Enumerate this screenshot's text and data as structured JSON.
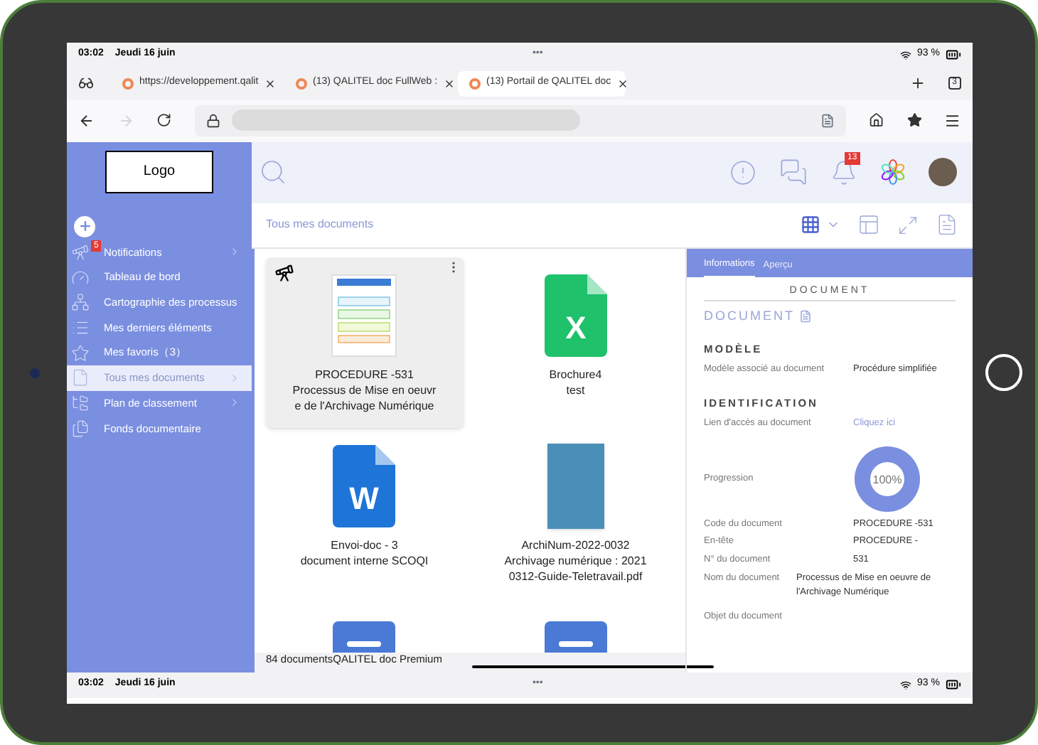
{
  "status_bar": {
    "time": "03:02",
    "date": "Jeudi 16 juin",
    "dots": "•••",
    "battery": "93 %"
  },
  "browser": {
    "tabs": [
      {
        "title": "https://developpement.qalit",
        "selected": false
      },
      {
        "title": "(13) QALITEL doc FullWeb :",
        "selected": false
      },
      {
        "title": "(13) Portail de QALITEL doc",
        "selected": true
      }
    ],
    "tab_count": "3"
  },
  "sidebar": {
    "logo": "Logo",
    "items": [
      {
        "label": "Notifications",
        "badge": "5",
        "chevron": true,
        "selected": false
      },
      {
        "label": "Tableau de bord",
        "chevron": false,
        "selected": false
      },
      {
        "label": "Cartographie des processus",
        "chevron": false,
        "selected": false
      },
      {
        "label": "Mes derniers éléments",
        "chevron": false,
        "selected": false
      },
      {
        "label": "Mes favoris（3）",
        "chevron": false,
        "selected": false
      },
      {
        "label": "Tous mes documents",
        "chevron": true,
        "selected": true
      },
      {
        "label": "Plan de classement",
        "chevron": true,
        "selected": false
      },
      {
        "label": "Fonds documentaire",
        "chevron": false,
        "selected": false
      }
    ]
  },
  "header": {
    "notification_count": "13"
  },
  "breadcrumb": "Tous mes documents",
  "files": [
    {
      "kind": "procedure",
      "lines": [
        "PROCEDURE -531",
        "Processus de Mise en oeuvr",
        "e de l'Archivage Numérique"
      ],
      "selected": true
    },
    {
      "kind": "excel",
      "icon_letter": "X",
      "lines": [
        "Brochure4",
        "test"
      ],
      "selected": false
    },
    {
      "kind": "word",
      "icon_letter": "W",
      "lines": [
        "Envoi-doc - 3",
        "document interne SCOQI"
      ],
      "selected": false
    },
    {
      "kind": "cover",
      "lines": [
        "ArchiNum-2022-0032",
        "Archivage numérique : 2021",
        "0312-Guide-Teletravail.pdf"
      ],
      "selected": false
    },
    {
      "kind": "doc",
      "selected": false
    },
    {
      "kind": "doc",
      "selected": false
    }
  ],
  "footer": "84 documentsQALITEL doc Premium",
  "panel": {
    "tabs": [
      {
        "label": "Informations",
        "selected": true
      },
      {
        "label": "Aperçu",
        "selected": false
      }
    ],
    "section_title": "DOCUMENT",
    "doc_label": "DOCUMENT",
    "groups": [
      {
        "title": "MODÈLE",
        "rows": [
          {
            "kind": "text",
            "label": "Modèle associé au document",
            "value": "Procédure simplifiée"
          }
        ]
      },
      {
        "title": "IDENTIFICATION",
        "rows": [
          {
            "kind": "link",
            "label": "Lien d'accès au document",
            "value": "Cliquez ici"
          },
          {
            "kind": "progress",
            "label": "Progression",
            "value": "100%",
            "level": 1
          },
          {
            "kind": "text",
            "label": "Code du document",
            "value": "PROCEDURE -531"
          },
          {
            "kind": "text",
            "label": "En-tête",
            "value": "PROCEDURE -"
          },
          {
            "kind": "text",
            "label": "N° du document",
            "value": "531"
          },
          {
            "kind": "wide",
            "label": "Nom du document",
            "value": "Processus de Mise en oeuvre de l'Archivage Numérique"
          },
          {
            "kind": "text",
            "label": "Objet du document"
          }
        ]
      }
    ]
  },
  "bottom_status": {
    "time": "03:02",
    "date": "Jeudi 16 juin",
    "dots": "•••",
    "battery": "93 %"
  }
}
